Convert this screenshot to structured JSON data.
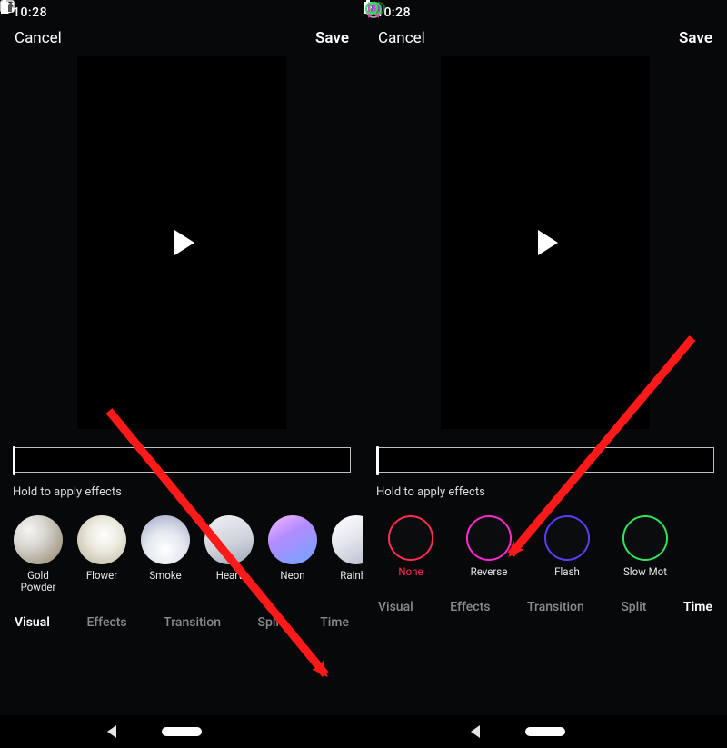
{
  "left": {
    "status": {
      "time": "10:28"
    },
    "nav": {
      "cancel": "Cancel",
      "save": "Save"
    },
    "hint": "Hold to apply effects",
    "effects": [
      {
        "label": "Gold Powder"
      },
      {
        "label": "Flower"
      },
      {
        "label": "Smoke"
      },
      {
        "label": "Heart"
      },
      {
        "label": "Neon"
      },
      {
        "label": "Rainbo"
      }
    ],
    "tabs": {
      "visual": "Visual",
      "effects": "Effects",
      "transition": "Transition",
      "split": "Split",
      "time": "Time"
    }
  },
  "right": {
    "status": {
      "time": "10:28"
    },
    "nav": {
      "cancel": "Cancel",
      "save": "Save"
    },
    "hint": "Hold to apply effects",
    "effects": [
      {
        "label": "None"
      },
      {
        "label": "Reverse"
      },
      {
        "label": "Flash"
      },
      {
        "label": "Slow Mot"
      }
    ],
    "tabs": {
      "visual": "Visual",
      "effects": "Effects",
      "transition": "Transition",
      "split": "Split",
      "time": "Time"
    }
  }
}
